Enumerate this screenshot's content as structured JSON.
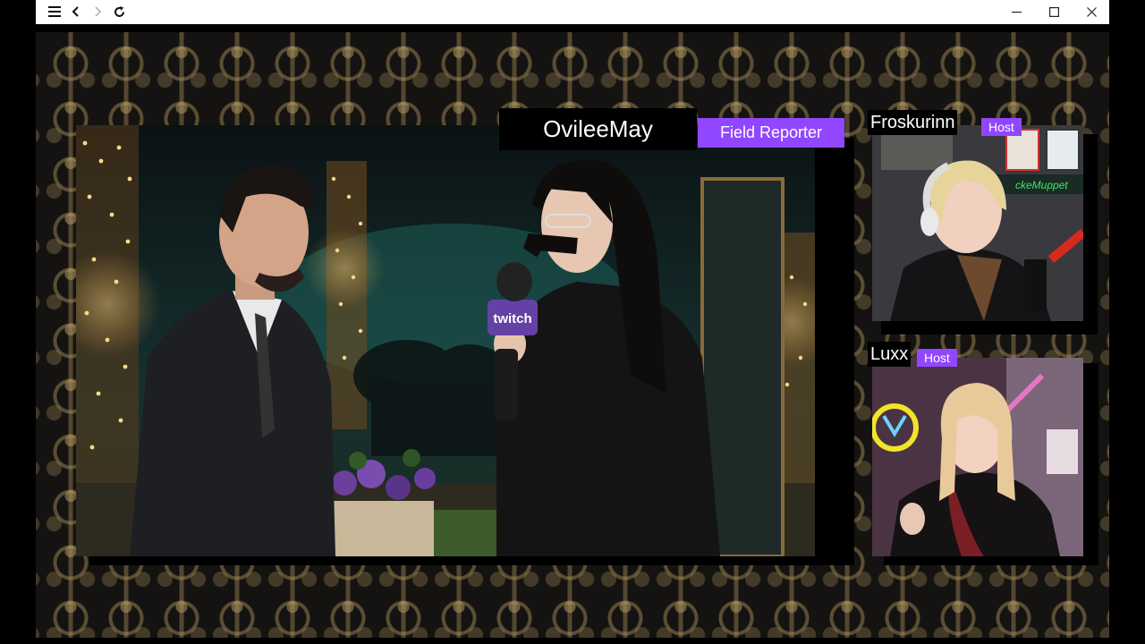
{
  "window": {
    "controls": {
      "menu_icon": "hamburger-menu-icon",
      "back_icon": "chevron-left-icon",
      "forward_icon": "chevron-right-icon",
      "reload_icon": "reload-icon",
      "minimize_icon": "minimize-icon",
      "maximize_icon": "maximize-icon",
      "close_icon": "close-icon"
    }
  },
  "stream": {
    "field_reporter": {
      "name": "OvileeMay",
      "role": "Field Reporter"
    },
    "hosts": [
      {
        "name": "Froskurinn",
        "role": "Host"
      },
      {
        "name": "Luxx",
        "role": "Host"
      }
    ],
    "mic_flag_text": "twitch"
  },
  "colors": {
    "accent": "#9147ff",
    "background_pattern_gold": "#b1965f",
    "background_dark": "#141311"
  }
}
